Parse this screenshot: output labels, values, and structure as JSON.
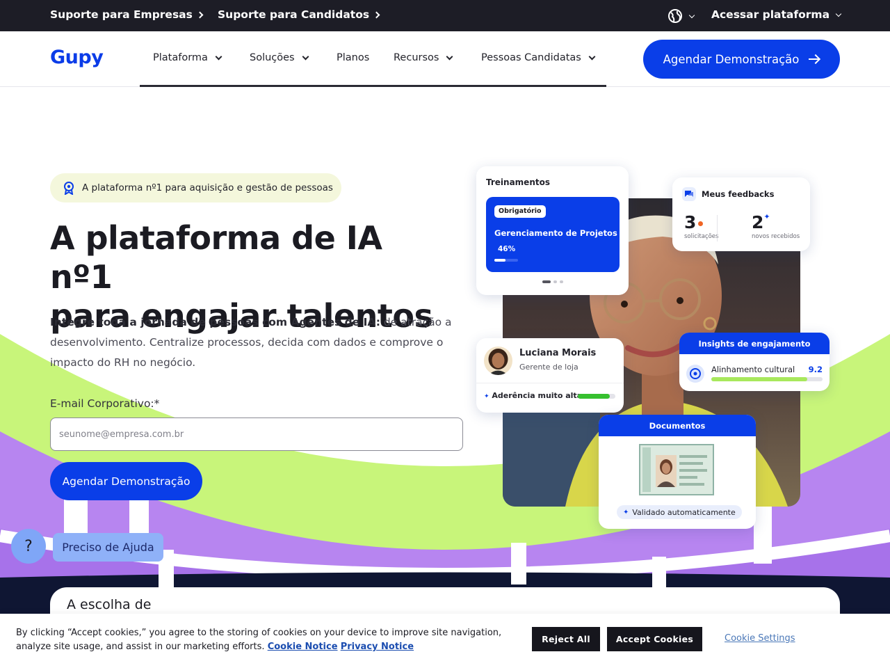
{
  "topbar": {
    "support_companies": "Suporte para Empresas",
    "support_candidates": "Suporte para Candidatos",
    "access_platform": "Acessar plataforma"
  },
  "nav": {
    "logo": "Gupy",
    "items": [
      "Plataforma",
      "Soluções",
      "Planos",
      "Recursos",
      "Pessoas Candidatas"
    ],
    "cta": "Agendar Demonstração"
  },
  "hero": {
    "badge": "A plataforma nº1 para aquisição e gestão de pessoas",
    "title_line1": "A plataforma de IA nº1",
    "title_line2": "para engajar talentos",
    "desc_bold": "Integre toda a jornada de pessoas com Agentes de IA:",
    "desc_rest": " de atração a desenvolvimento. Centralize processos, decida com dados e comprove o impacto do RH no negócio.",
    "email_label": "E-mail Corporativo:*",
    "email_placeholder": "seunome@empresa.com.br",
    "cta": "Agendar Demonstração"
  },
  "cards": {
    "training": {
      "title": "Treinamentos",
      "tag": "Obrigatório",
      "course": "Gerenciamento de Projetos",
      "progress_label": "46%",
      "progress": 0.46
    },
    "feedbacks": {
      "title": "Meus feedbacks",
      "requests_value": "3",
      "requests_label": "solicitações",
      "received_value": "2",
      "received_label": "novos recebidos"
    },
    "profile": {
      "name": "Luciana Morais",
      "role": "Gerente de loja",
      "adherence": "Aderência muito alta",
      "adherence_level": 0.85
    },
    "insights": {
      "title": "Insights de engajamento",
      "metric": "Alinhamento cultural",
      "value": "9.2",
      "level": 0.86
    },
    "documents": {
      "title": "Documentos",
      "status": "Validado automaticamente"
    }
  },
  "help": {
    "icon_label": "?",
    "label": "Preciso de Ajuda"
  },
  "choice": {
    "text": "A escolha de"
  },
  "cookie": {
    "text": "By clicking “Accept cookies,” you agree to the storing of cookies on your device to improve site navigation, analyze site usage, and assist in our marketing efforts.",
    "cookie_notice": "Cookie Notice",
    "privacy_notice": "Privacy Notice",
    "reject": "Reject All",
    "accept": "Accept Cookies",
    "settings": "Cookie Settings"
  },
  "colors": {
    "brand_blue": "#0a3ee8",
    "topbar": "#1d1d26",
    "lime": "#c8f57a",
    "purple": "#b785f0",
    "navy": "#0f1633"
  }
}
